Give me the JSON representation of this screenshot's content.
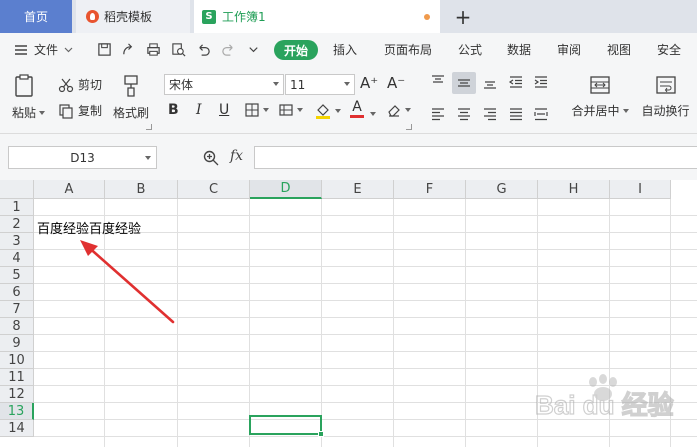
{
  "tabs": {
    "home": "首页",
    "template": "稻壳模板",
    "workbook": "工作簿1",
    "workbook_icon": "S"
  },
  "menu": {
    "file": "文件",
    "items": [
      "开始",
      "插入",
      "页面布局",
      "公式",
      "数据",
      "审阅",
      "视图",
      "安全"
    ]
  },
  "ribbon": {
    "paste": "粘贴",
    "cut": "剪切",
    "copy": "复制",
    "format_painter": "格式刷",
    "font_name": "宋体",
    "font_size": "11",
    "bold": "B",
    "italic": "I",
    "underline": "U",
    "font_color_letter": "A",
    "font_grow": "A⁺",
    "font_shrink": "A⁻",
    "merge_center": "合并居中",
    "wrap_text": "自动换行"
  },
  "formula_bar": {
    "name_box": "D13",
    "fx_label": "fx",
    "formula_value": ""
  },
  "grid": {
    "columns": [
      "A",
      "B",
      "C",
      "D",
      "E",
      "F",
      "G",
      "H",
      "I"
    ],
    "rows": [
      "1",
      "2",
      "3",
      "4",
      "5",
      "6",
      "7",
      "8",
      "9",
      "10",
      "11",
      "12",
      "13",
      "14"
    ],
    "active_column": "D",
    "active_row": "13",
    "cell_A2": "百度经验百度经验"
  },
  "watermark": {
    "text": "Bai du 经验"
  },
  "colors": {
    "accent_green": "#2aa35d",
    "home_tab_blue": "#5b7fcf",
    "annotation_red": "#e03030"
  }
}
